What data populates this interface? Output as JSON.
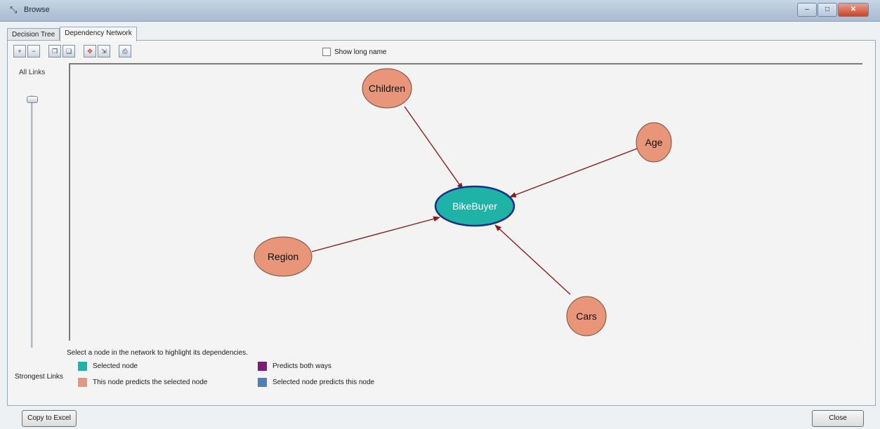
{
  "window": {
    "title": "Browse",
    "icon": "browse-arrow-icon"
  },
  "tabs": [
    {
      "label": "Decision Tree",
      "active": false
    },
    {
      "label": "Dependency Network",
      "active": true
    }
  ],
  "toolbar": {
    "buttons": [
      "zoom-in-icon",
      "zoom-out-icon",
      "copy-icon",
      "copy-graph-icon",
      "fit-icon",
      "size-icon",
      "print-icon"
    ]
  },
  "show_long_name": {
    "label": "Show long name",
    "checked": false
  },
  "links_slider": {
    "label": "All Links",
    "level": 0
  },
  "network": {
    "nodes": [
      {
        "id": "bikebuyer",
        "label": "BikeBuyer",
        "role": "selected"
      },
      {
        "id": "children",
        "label": "Children",
        "role": "predicts-selected"
      },
      {
        "id": "age",
        "label": "Age",
        "role": "predicts-selected"
      },
      {
        "id": "region",
        "label": "Region",
        "role": "predicts-selected"
      },
      {
        "id": "cars",
        "label": "Cars",
        "role": "predicts-selected"
      }
    ],
    "edges": [
      {
        "from": "children",
        "to": "bikebuyer"
      },
      {
        "from": "age",
        "to": "bikebuyer"
      },
      {
        "from": "region",
        "to": "bikebuyer"
      },
      {
        "from": "cars",
        "to": "bikebuyer"
      }
    ]
  },
  "hint": "Select a node in the network to highlight its dependencies.",
  "legend": {
    "title": "Strongest Links",
    "items": [
      {
        "label": "Selected node",
        "color": "#1fb2a6"
      },
      {
        "label": "This node predicts the selected node",
        "color": "#e8957a"
      },
      {
        "label": "Predicts both ways",
        "color": "#7e1a77"
      },
      {
        "label": "Selected node predicts this node",
        "color": "#4f7fb6"
      }
    ]
  },
  "colors": {
    "selected_fill": "#1fb2a6",
    "selected_border": "#1a2d8c",
    "predictor_fill": "#e8957a",
    "edge": "#8b1c1c"
  },
  "footer": {
    "copy_button": "Copy to Excel",
    "close_button": "Close"
  }
}
